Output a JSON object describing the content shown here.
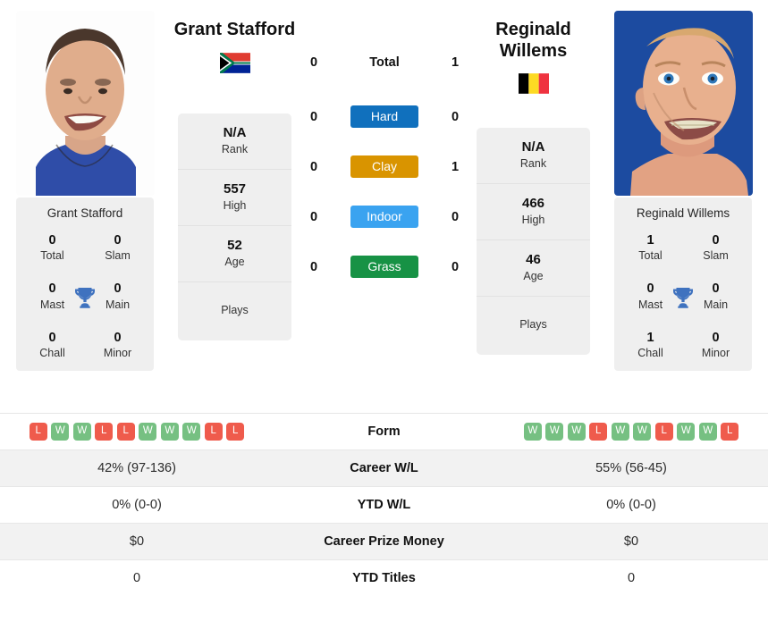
{
  "players": {
    "left": {
      "name": "Grant Stafford",
      "card_name": "Grant Stafford",
      "flag": "south-africa-flag",
      "rank": "N/A",
      "rank_label": "Rank",
      "high": "557",
      "high_label": "High",
      "age": "52",
      "age_label": "Age",
      "plays": "",
      "plays_label": "Plays",
      "titles": {
        "total": "0",
        "total_label": "Total",
        "slam": "0",
        "slam_label": "Slam",
        "mast": "0",
        "mast_label": "Mast",
        "main": "0",
        "main_label": "Main",
        "chall": "0",
        "chall_label": "Chall",
        "minor": "0",
        "minor_label": "Minor"
      },
      "form": [
        "L",
        "W",
        "W",
        "L",
        "L",
        "W",
        "W",
        "W",
        "L",
        "L"
      ],
      "career_wl": "42% (97-136)",
      "ytd_wl": "0% (0-0)",
      "career_prize_money": "$0",
      "ytd_titles": "0"
    },
    "right": {
      "name": "Reginald Willems",
      "card_name": "Reginald Willems",
      "flag": "belgium-flag",
      "rank": "N/A",
      "rank_label": "Rank",
      "high": "466",
      "high_label": "High",
      "age": "46",
      "age_label": "Age",
      "plays": "",
      "plays_label": "Plays",
      "titles": {
        "total": "1",
        "total_label": "Total",
        "slam": "0",
        "slam_label": "Slam",
        "mast": "0",
        "mast_label": "Mast",
        "main": "0",
        "main_label": "Main",
        "chall": "1",
        "chall_label": "Chall",
        "minor": "0",
        "minor_label": "Minor"
      },
      "form": [
        "W",
        "W",
        "W",
        "L",
        "W",
        "W",
        "L",
        "W",
        "W",
        "L"
      ],
      "career_wl": "55% (56-45)",
      "ytd_wl": "0% (0-0)",
      "career_prize_money": "$0",
      "ytd_titles": "0"
    }
  },
  "head_to_head": [
    {
      "key": "total",
      "label": "Total",
      "left": "0",
      "right": "1",
      "badge": false,
      "color": ""
    },
    {
      "key": "hard",
      "label": "Hard",
      "left": "0",
      "right": "0",
      "badge": true,
      "color": "#1070bd"
    },
    {
      "key": "clay",
      "label": "Clay",
      "left": "0",
      "right": "1",
      "badge": true,
      "color": "#d99400"
    },
    {
      "key": "indoor",
      "label": "Indoor",
      "left": "0",
      "right": "0",
      "badge": true,
      "color": "#3aa3f0"
    },
    {
      "key": "grass",
      "label": "Grass",
      "left": "0",
      "right": "0",
      "badge": true,
      "color": "#179245"
    }
  ],
  "comparison_rows": [
    {
      "key": "form",
      "label": "Form",
      "type": "form",
      "shaded": false
    },
    {
      "key": "career_wl",
      "label": "Career W/L",
      "type": "text",
      "shaded": true
    },
    {
      "key": "ytd_wl",
      "label": "YTD W/L",
      "type": "text",
      "shaded": false
    },
    {
      "key": "career_prize_money",
      "label": "Career Prize Money",
      "type": "text",
      "shaded": true
    },
    {
      "key": "ytd_titles",
      "label": "YTD Titles",
      "type": "text",
      "shaded": false
    }
  ],
  "colors": {
    "win": "#76c082",
    "loss": "#ef5b4c",
    "card_bg": "#efefef",
    "row_shaded": "#f2f2f2",
    "trophy": "#3f72bf"
  },
  "icons": {
    "trophy": "trophy-icon"
  }
}
